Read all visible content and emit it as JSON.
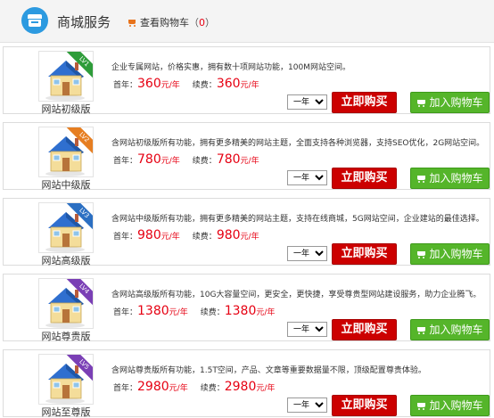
{
  "header": {
    "title": "商城服务",
    "cart_label": "查看购物车",
    "cart_open": "（",
    "cart_count": "0",
    "cart_close": "）",
    "store_icon": "store-icon",
    "cart_icon": "shopping-cart-icon"
  },
  "products": [
    {
      "name": "网站初级版",
      "level": "LV1",
      "ribbon_color": "#2e9c3a",
      "desc": "企业专属网站，价格实惠，拥有数十项网站功能，100M网站空间。",
      "first_year_label": "首年：",
      "first_year_price": "360",
      "unit": "元/年",
      "renew_label": "续费：",
      "renew_price": "360",
      "term": "一年",
      "buy_label": "立即购买",
      "cart_label": "加入购物车"
    },
    {
      "name": "网站中级版",
      "level": "LV2",
      "ribbon_color": "#e67e22",
      "desc": "含网站初级版所有功能，拥有更多精美的网站主题，全面支持各种浏览器，支持SEO优化，2G网站空间。",
      "first_year_label": "首年：",
      "first_year_price": "780",
      "unit": "元/年",
      "renew_label": "续费：",
      "renew_price": "780",
      "term": "一年",
      "buy_label": "立即购买",
      "cart_label": "加入购物车"
    },
    {
      "name": "网站高级版",
      "level": "LV3",
      "ribbon_color": "#2b6fc2",
      "desc": "含网站中级版所有功能，拥有更多精美的网站主题，支持在线商城，5G网站空间，企业建站的最佳选择。",
      "first_year_label": "首年：",
      "first_year_price": "980",
      "unit": "元/年",
      "renew_label": "续费：",
      "renew_price": "980",
      "term": "一年",
      "buy_label": "立即购买",
      "cart_label": "加入购物车"
    },
    {
      "name": "网站尊贵版",
      "level": "LV4",
      "ribbon_color": "#7a3fb5",
      "desc": "含网站高级版所有功能，10G大容量空间，更安全，更快捷，享受尊贵型网站建设服务，助力企业腾飞。",
      "first_year_label": "首年：",
      "first_year_price": "1380",
      "unit": "元/年",
      "renew_label": "续费：",
      "renew_price": "1380",
      "term": "一年",
      "buy_label": "立即购买",
      "cart_label": "加入购物车"
    },
    {
      "name": "网站至尊版",
      "level": "LV5",
      "ribbon_color": "#7a3fb5",
      "desc": "含网站尊贵版所有功能，1.5T空间，产品、文章等重要数据量不限，顶级配置尊贵体验。",
      "first_year_label": "首年：",
      "first_year_price": "2980",
      "unit": "元/年",
      "renew_label": "续费：",
      "renew_price": "2980",
      "term": "一年",
      "buy_label": "立即购买",
      "cart_label": "加入购物车"
    }
  ]
}
